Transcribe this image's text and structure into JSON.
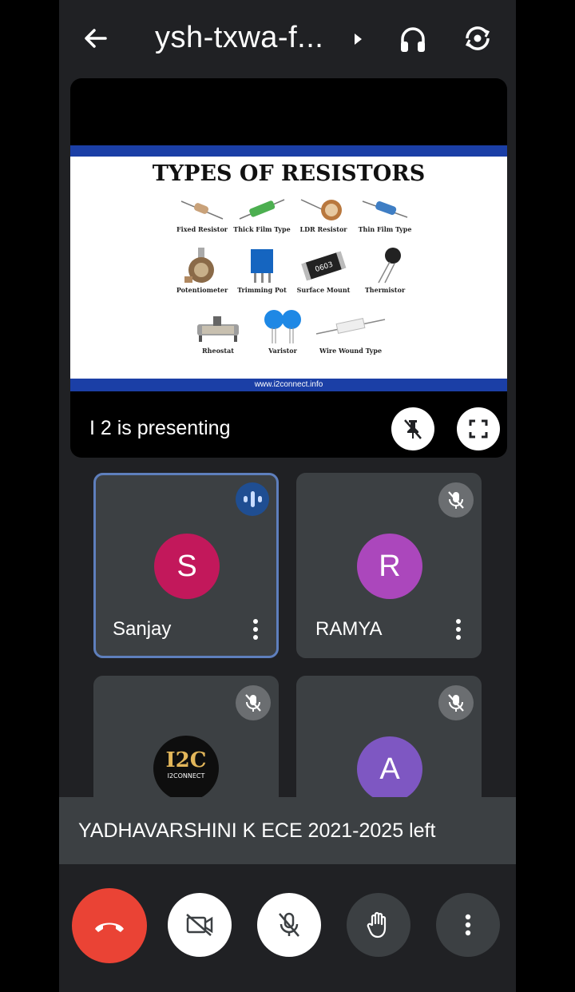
{
  "header": {
    "meeting_code": "ysh-txwa-f...",
    "icons": [
      "back-arrow-icon",
      "expand-arrow-icon",
      "headphones-icon",
      "switch-camera-icon"
    ]
  },
  "presentation": {
    "slide": {
      "title": "TYPES OF RESISTORS",
      "items": [
        "Fixed Resistor",
        "Thick Film Type",
        "LDR Resistor",
        "Thin Film Type",
        "Potentiometer",
        "Trimming Pot",
        "Surface Mount",
        "Thermistor",
        "Rheostat",
        "Varistor",
        "Wire Wound Type"
      ],
      "footer": "www.i2connect.info",
      "smd_marking": "0603"
    },
    "status": "I 2 is presenting",
    "icons": [
      "unpin-icon",
      "fullscreen-icon"
    ]
  },
  "participants": [
    {
      "name": "Sanjay",
      "initial": "S",
      "color": "#c2185b",
      "state": "speaking"
    },
    {
      "name": "RAMYA",
      "initial": "R",
      "color": "#ab47bc",
      "state": "muted"
    },
    {
      "name": "",
      "logo_text": "I2C",
      "logo_sub": "I2CONNECT",
      "state": "muted"
    },
    {
      "name": "",
      "initial": "A",
      "color": "#7e57c2",
      "state": "muted"
    }
  ],
  "toast": {
    "message": "YADHAVARSHINI K ECE 2021-2025 left"
  },
  "controls": {
    "icons": [
      "end-call-icon",
      "camera-off-icon",
      "mic-off-icon",
      "raise-hand-icon",
      "more-options-icon"
    ],
    "colors": {
      "end_call": "#ea4335",
      "on": "#ffffff",
      "off": "#3c4043"
    }
  },
  "theme": {
    "background": "#202124",
    "tile": "#3c4043",
    "accent": "#1b3fa6"
  }
}
